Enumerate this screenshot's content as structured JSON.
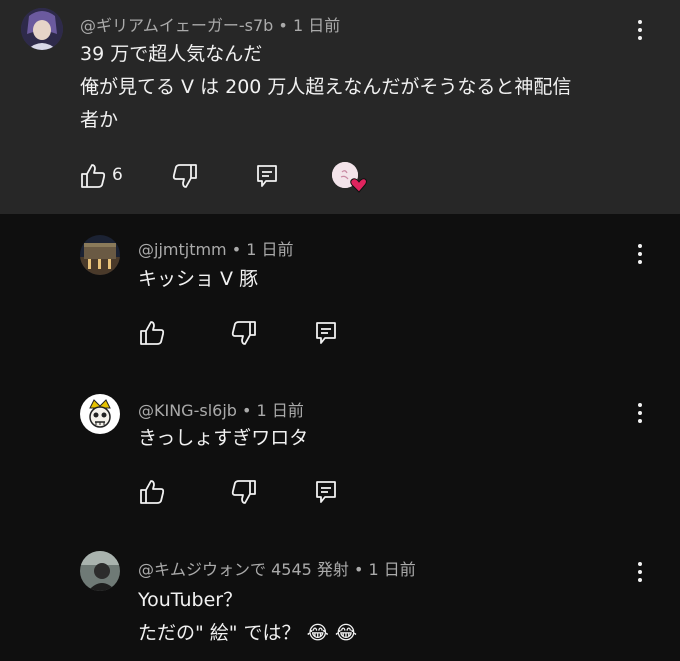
{
  "comment": {
    "author": "@ギリアムイェーガー-s7b",
    "time": "1 日前",
    "lines": [
      "39 万で超人気なんだ",
      "俺が見てる V は 200 万人超えなんだがそうなると神配信",
      "者か"
    ],
    "like_count": "6"
  },
  "replies": [
    {
      "author": "@jjmtjtmm",
      "time": "1 日前",
      "lines": [
        "キッショ V 豚"
      ]
    },
    {
      "author": "@KING-sl6jb",
      "time": "1 日前",
      "lines": [
        "きっしょすぎワロタ"
      ]
    },
    {
      "author": "@キムジウォンで 4545 発射",
      "time": "1 日前",
      "lines": [
        "YouTuber？",
        "ただの\" 絵\" では？ 😂 😂"
      ]
    }
  ],
  "colors": {
    "top_bg": "#272727",
    "page_bg": "#0f0f0f",
    "text": "#f1f1f1",
    "meta": "#aaaaaa",
    "heart": "#e0245e"
  }
}
